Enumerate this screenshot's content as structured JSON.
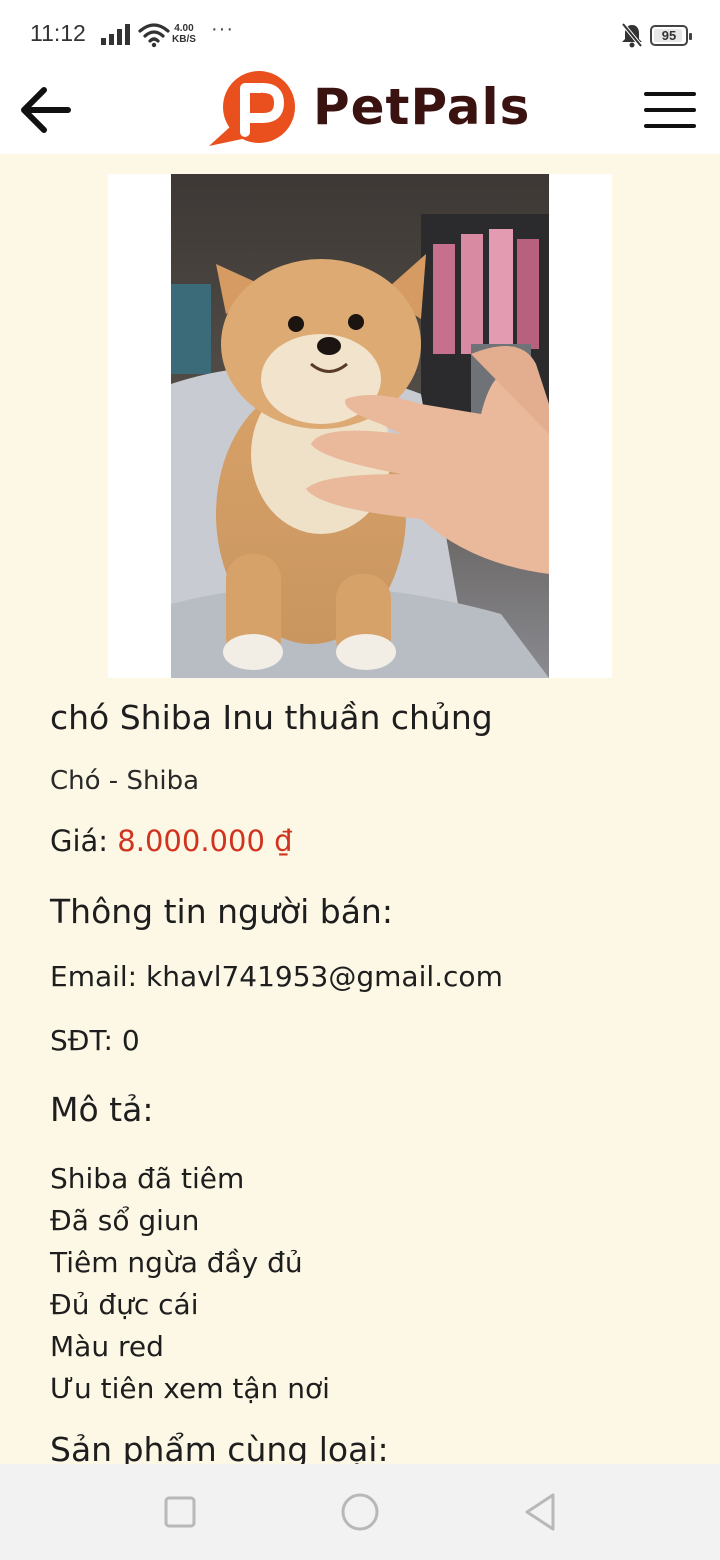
{
  "status_bar": {
    "time": "11:12",
    "speed_value": "4.00",
    "speed_unit": "KB/S",
    "more": "···",
    "battery": "95",
    "signal_icon": "signal-bars-icon",
    "wifi_icon": "wifi-icon",
    "bell_icon": "bell-muted-icon"
  },
  "header": {
    "back_icon": "arrow-left-icon",
    "logo_text": "PetPals",
    "logo_icon": "paw-chat-bubble-icon",
    "menu_icon": "hamburger-menu-icon",
    "brand_color": "#ea4f1e"
  },
  "product": {
    "photo_description_icon": "shiba-puppy-photo",
    "title": "chó Shiba Inu thuần chủng",
    "category": "Chó - Shiba",
    "price_label": "Giá:",
    "price_value": "8.000.000 ₫",
    "price_color": "#d0341f"
  },
  "seller": {
    "heading": "Thông tin người bán:",
    "email": "Email: khavl741953@gmail.com",
    "phone": "SĐT: 0"
  },
  "description": {
    "heading": "Mô tả:",
    "lines": [
      "Shiba đã tiêm",
      "Đã sổ giun",
      "Tiêm ngừa đầy đủ",
      "Đủ đực cái",
      "Màu red",
      "Ưu tiên xem tận nơi"
    ]
  },
  "related": {
    "heading": "Sản phẩm cùng loại:"
  },
  "nav_bar": {
    "recents_icon": "square-recents-icon",
    "home_icon": "circle-home-icon",
    "back_icon": "triangle-back-icon"
  }
}
